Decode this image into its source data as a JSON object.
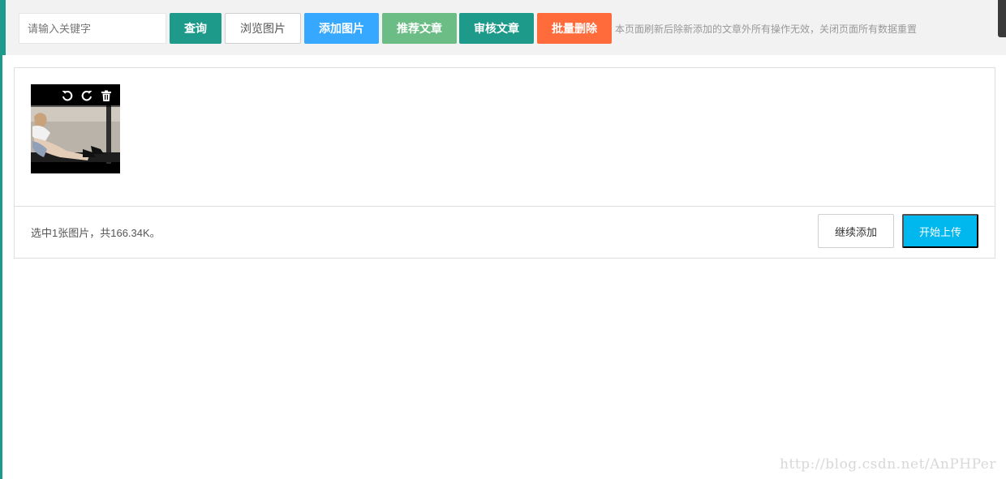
{
  "toolbar": {
    "search_placeholder": "请输入关键字",
    "query_label": "查询",
    "browse_label": "浏览图片",
    "add_image_label": "添加图片",
    "recommend_label": "推荐文章",
    "review_label": "审核文章",
    "batch_delete_label": "批量删除",
    "note": "本页面刷新后除新添加的文章外所有操作无效，关闭页面所有数据重置"
  },
  "uploader": {
    "thumbnail_icons": [
      "rotate-left-icon",
      "rotate-right-icon",
      "trash-icon"
    ],
    "status_text": "选中1张图片，共166.34K。",
    "continue_label": "继续添加",
    "upload_label": "开始上传"
  },
  "colors": {
    "teal": "#1e9a8a",
    "blue": "#36a8ff",
    "green": "#6bbd85",
    "orange": "#ff6b3b",
    "upload_blue": "#00b7ee"
  },
  "watermark": "http://blog.csdn.net/AnPHPer"
}
